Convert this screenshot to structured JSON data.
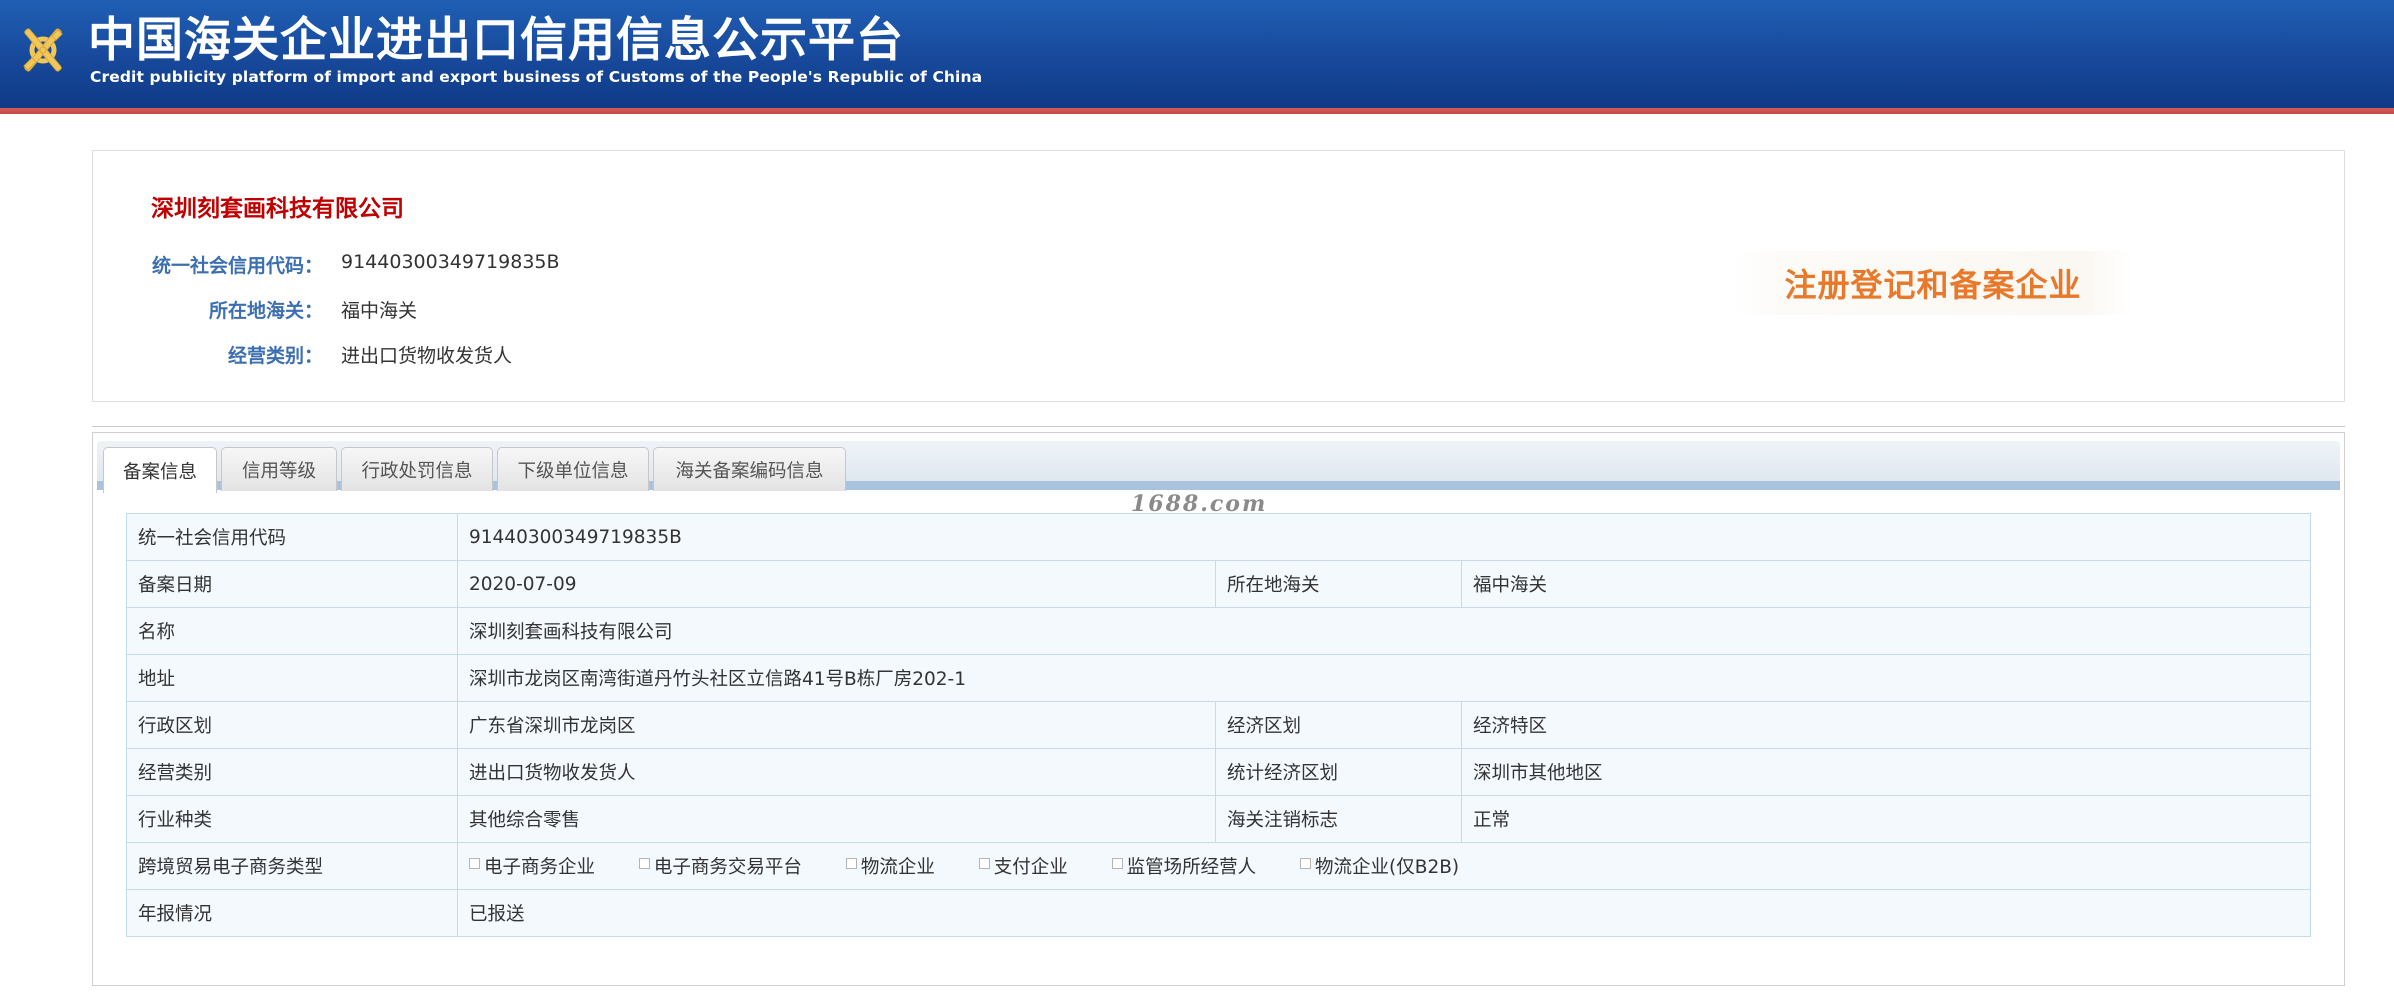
{
  "header": {
    "title": "中国海关企业进出口信用信息公示平台",
    "subtitle": "Credit publicity platform of import and export business of Customs of the People's Republic of China",
    "logo_icon": "customs-emblem-icon"
  },
  "company": {
    "name": "深圳刻套画科技有限公司",
    "credit_code_label": "统一社会信用代码：",
    "credit_code": "91440300349719835B",
    "customs_label": "所在地海关：",
    "customs": "福中海关",
    "category_label": "经营类别：",
    "category": "进出口货物收发货人",
    "stamp": "注册登记和备案企业"
  },
  "watermark": "1688.com",
  "tabs": [
    {
      "label": "备案信息",
      "active": true
    },
    {
      "label": "信用等级",
      "active": false
    },
    {
      "label": "行政处罚信息",
      "active": false
    },
    {
      "label": "下级单位信息",
      "active": false
    },
    {
      "label": "海关备案编码信息",
      "active": false
    }
  ],
  "detail": {
    "credit_code_label": "统一社会信用代码",
    "credit_code": "91440300349719835B",
    "record_date_label": "备案日期",
    "record_date": "2020-07-09",
    "customs_label": "所在地海关",
    "customs": "福中海关",
    "name_label": "名称",
    "name": "深圳刻套画科技有限公司",
    "address_label": "地址",
    "address": "深圳市龙岗区南湾街道丹竹头社区立信路41号B栋厂房202-1",
    "admin_region_label": "行政区划",
    "admin_region": "广东省深圳市龙岗区",
    "econ_region_label": "经济区划",
    "econ_region": "经济特区",
    "category_label": "经营类别",
    "category": "进出口货物收发货人",
    "stat_region_label": "统计经济区划",
    "stat_region": "深圳市其他地区",
    "industry_label": "行业种类",
    "industry": "其他综合零售",
    "cancel_flag_label": "海关注销标志",
    "cancel_flag": "正常",
    "ecommerce_label": "跨境贸易电子商务类型",
    "ecommerce_options": [
      {
        "label": "电子商务企业",
        "checked": false
      },
      {
        "label": "电子商务交易平台",
        "checked": false
      },
      {
        "label": "物流企业",
        "checked": false
      },
      {
        "label": "支付企业",
        "checked": false
      },
      {
        "label": "监管场所经营人",
        "checked": false
      },
      {
        "label": "物流企业(仅B2B)",
        "checked": false
      }
    ],
    "annual_report_label": "年报情况",
    "annual_report": "已报送"
  },
  "colors": {
    "header_blue": "#17489a",
    "header_red_line": "#c44848",
    "company_name_red": "#c00000",
    "label_blue": "#3c6fb0",
    "stamp_orange": "#e8782a",
    "table_border": "#c3dcec",
    "table_bg": "#f4f9fd"
  }
}
